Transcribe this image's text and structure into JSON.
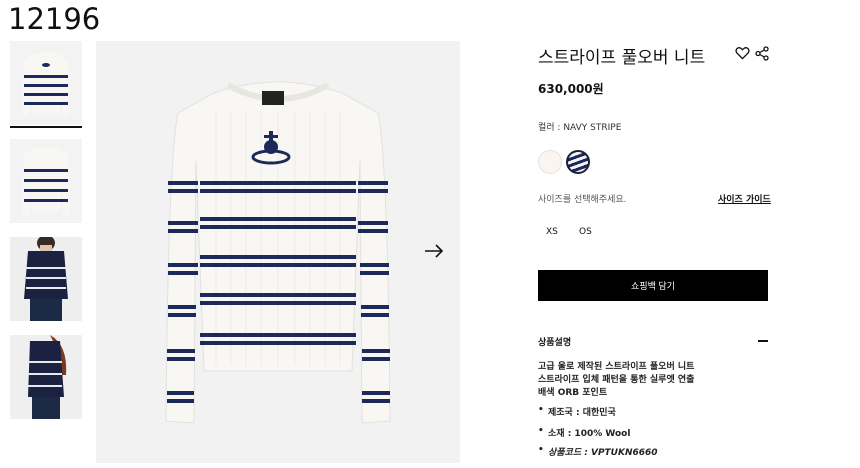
{
  "page_id": "12196",
  "product": {
    "title": "스트라이프 풀오버 니트",
    "price": "630,000원",
    "color_label": "컬러 : NAVY STRIPE",
    "swatches": [
      "ivory",
      "navy-stripe"
    ],
    "size_prompt": "사이즈를 선택해주세요.",
    "size_guide": "사이즈 가이드",
    "sizes": [
      "XS",
      "OS"
    ],
    "add_to_bag": "쇼핑백 담기"
  },
  "details": {
    "section_title": "상품설명",
    "description": [
      "고급 울로 제작된 스트라이프 풀오버 니트",
      "스트라이프 입체 패턴을 통한 실루엣 연출",
      "배색 ORB 포인트"
    ],
    "bullets": [
      "제조국 : 대한민국",
      "소재 : 100% Wool",
      "상품코드 : VPTUKN6660"
    ]
  },
  "colors": {
    "navy": "#1b2a5a",
    "knit": "#f7f6f2",
    "button": "#000000"
  }
}
